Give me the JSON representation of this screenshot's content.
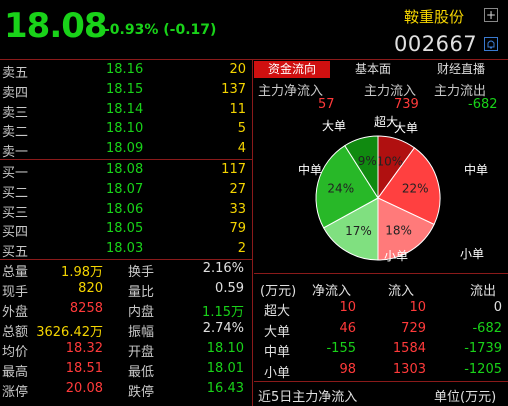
{
  "header": {
    "price": "18.08",
    "change": "-0.93% (-0.17)",
    "stock_name": "鞍重股份",
    "stock_code": "002667",
    "add_icon": "plus-icon",
    "alert_icon": "bell-icon"
  },
  "order_book": {
    "asks": [
      {
        "label": "卖五",
        "price": "18.16",
        "volume": "20"
      },
      {
        "label": "卖四",
        "price": "18.15",
        "volume": "137"
      },
      {
        "label": "卖三",
        "price": "18.14",
        "volume": "11"
      },
      {
        "label": "卖二",
        "price": "18.10",
        "volume": "5"
      },
      {
        "label": "卖一",
        "price": "18.09",
        "volume": "4"
      }
    ],
    "bids": [
      {
        "label": "买一",
        "price": "18.08",
        "volume": "117"
      },
      {
        "label": "买二",
        "price": "18.07",
        "volume": "27"
      },
      {
        "label": "买三",
        "price": "18.06",
        "volume": "33"
      },
      {
        "label": "买四",
        "price": "18.05",
        "volume": "79"
      },
      {
        "label": "买五",
        "price": "18.03",
        "volume": "2"
      }
    ]
  },
  "stats": [
    {
      "l1": "总量",
      "v1": "1.98万",
      "l2": "换手",
      "v2": "2.16%"
    },
    {
      "l1": "现手",
      "v1": "820",
      "l2": "量比",
      "v2": "0.59"
    },
    {
      "l1": "外盘",
      "v1": "8258",
      "l2": "内盘",
      "v2": "1.15万"
    },
    {
      "l1": "总额",
      "v1": "3626.42万",
      "l2": "振幅",
      "v2": "2.74%"
    },
    {
      "l1": "均价",
      "v1": "18.32",
      "l2": "开盘",
      "v2": "18.10"
    },
    {
      "l1": "最高",
      "v1": "18.51",
      "l2": "最低",
      "v2": "18.01"
    },
    {
      "l1": "涨停",
      "v1": "20.08",
      "l2": "跌停",
      "v2": "16.43"
    }
  ],
  "tabs": [
    "资金流向",
    "基本面",
    "财经直播"
  ],
  "flow_summary": {
    "headers": [
      "主力净流入",
      "主力流入",
      "主力流出"
    ],
    "values": [
      "57",
      "739",
      "-682"
    ]
  },
  "pie": {
    "labels": [
      "超大",
      "大单",
      "中单",
      "小单",
      "小单",
      "中单",
      "大单"
    ],
    "chart_data": {
      "type": "pie",
      "slices": [
        {
          "name": "超大",
          "value": 10,
          "label": "10%"
        },
        {
          "name": "大单",
          "value": 22,
          "label": "22%"
        },
        {
          "name": "中单",
          "value": 18,
          "label": "18%"
        },
        {
          "name": "小单",
          "value": 17,
          "label": "17%"
        },
        {
          "name": "中单",
          "value": 24,
          "label": "24%"
        },
        {
          "name": "大单",
          "value": 9,
          "label": "9%"
        }
      ]
    }
  },
  "flow_table": {
    "headers": [
      "(万元)",
      "净流入",
      "流入",
      "流出"
    ],
    "rows": [
      {
        "cat": "超大",
        "net": "10",
        "in": "10",
        "out": "0"
      },
      {
        "cat": "大单",
        "net": "46",
        "in": "729",
        "out": "-682"
      },
      {
        "cat": "中单",
        "net": "-155",
        "in": "1584",
        "out": "-1739"
      },
      {
        "cat": "小单",
        "net": "98",
        "in": "1303",
        "out": "-1205"
      }
    ]
  },
  "footer": {
    "left": "近5日主力净流入",
    "right": "单位(万元)"
  }
}
